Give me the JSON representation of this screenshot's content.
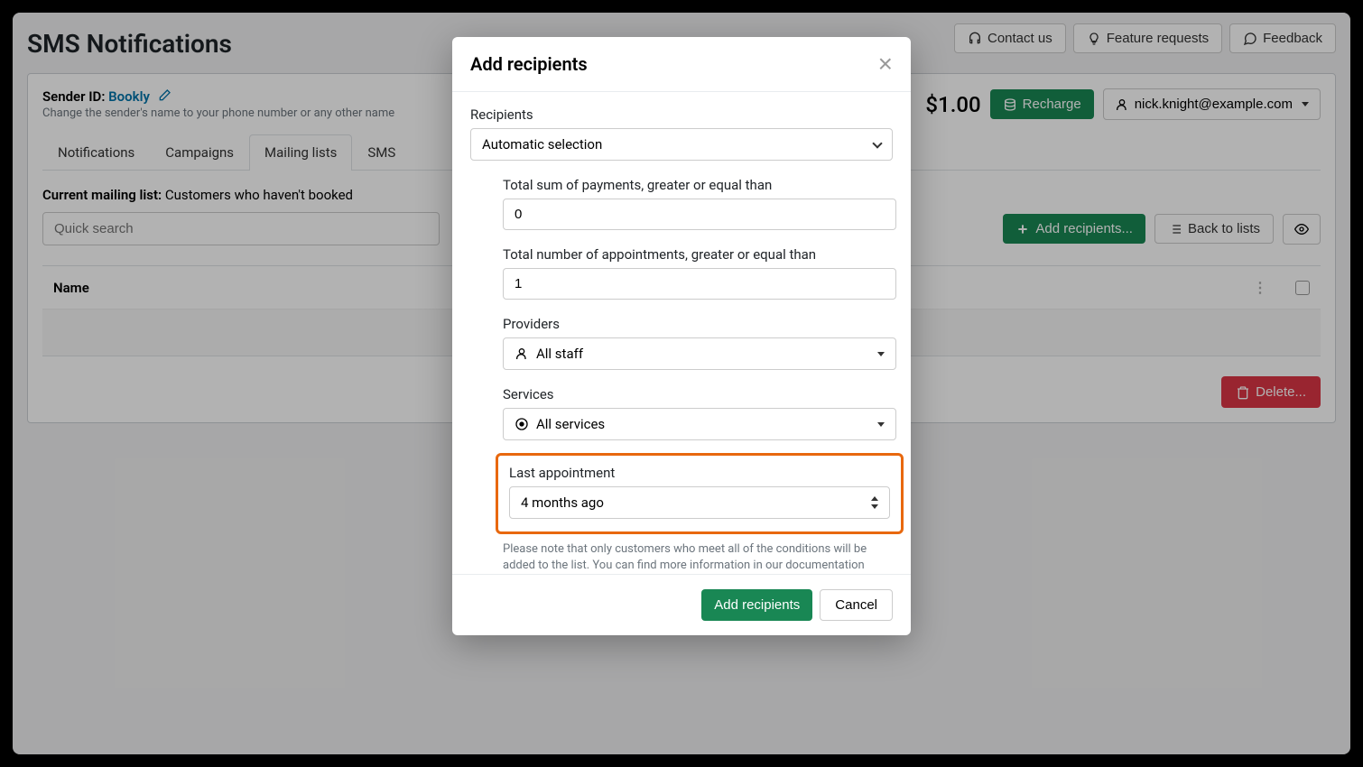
{
  "page": {
    "title": "SMS Notifications"
  },
  "header_buttons": {
    "contact": "Contact us",
    "feature": "Feature requests",
    "feedback": "Feedback"
  },
  "sender": {
    "label": "Sender ID:",
    "value": "Bookly",
    "sub": "Change the sender's name to your phone number or any other name"
  },
  "balance": {
    "amount": "$1.00",
    "recharge": "Recharge",
    "user": "nick.knight@example.com"
  },
  "tabs": {
    "notifications": "Notifications",
    "campaigns": "Campaigns",
    "mailing": "Mailing lists",
    "sms": "SMS"
  },
  "mailing": {
    "label": "Current mailing list:",
    "name": "Customers who haven't booked"
  },
  "search": {
    "placeholder": "Quick search",
    "add_recipients": "Add recipients...",
    "back": "Back to lists"
  },
  "table": {
    "col_name": "Name"
  },
  "delete_btn": "Delete...",
  "modal": {
    "title": "Add recipients",
    "recipients_label": "Recipients",
    "recipients_value": "Automatic selection",
    "sum_label": "Total sum of payments, greater or equal than",
    "sum_value": "0",
    "appts_label": "Total number of appointments, greater or equal than",
    "appts_value": "1",
    "providers_label": "Providers",
    "providers_value": "All staff",
    "services_label": "Services",
    "services_value": "All services",
    "last_label": "Last appointment",
    "last_value": "4 months ago",
    "note": "Please note that only customers who meet all of the conditions will be added to the list. You can find more information in our documentation",
    "submit": "Add recipients",
    "cancel": "Cancel"
  }
}
